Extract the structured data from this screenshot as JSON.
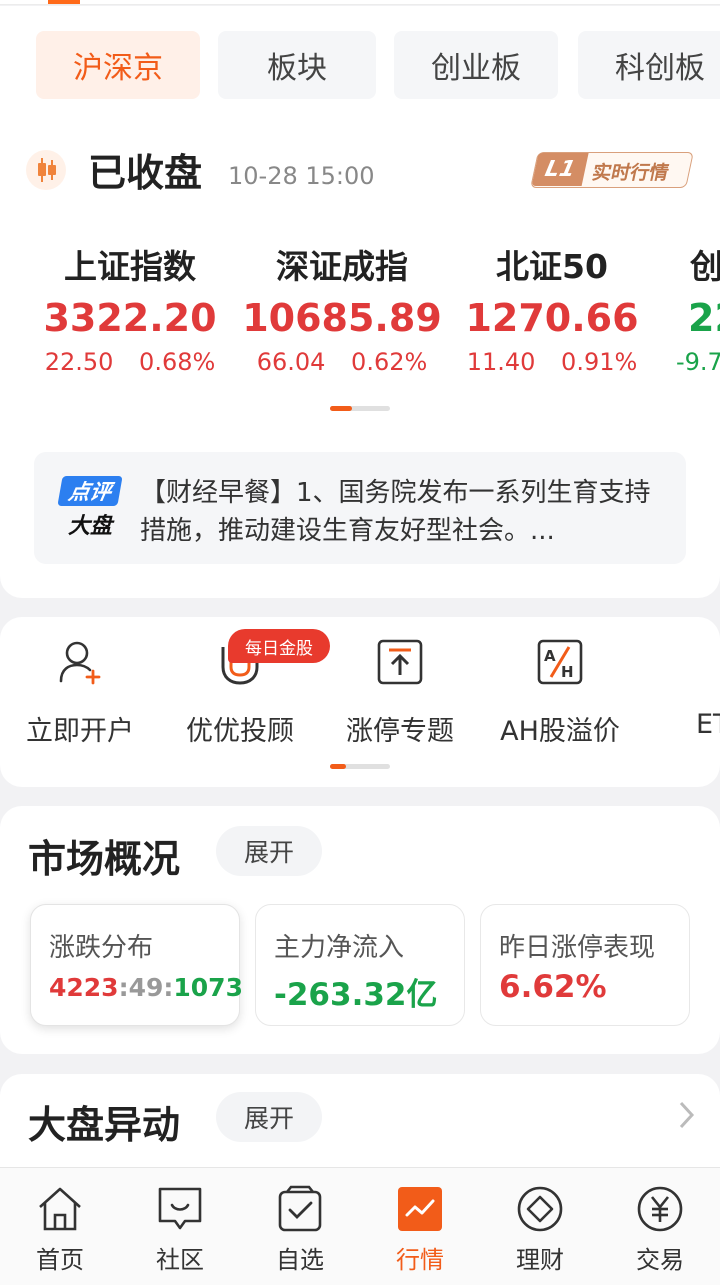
{
  "market_tabs": [
    {
      "label": "沪深京",
      "active": true
    },
    {
      "label": "板块",
      "active": false
    },
    {
      "label": "创业板",
      "active": false
    },
    {
      "label": "科创板",
      "active": false
    }
  ],
  "status": {
    "title": "已收盘",
    "time": "10-28 15:00",
    "badge_level": "L1",
    "badge_text": "实时行情"
  },
  "indices": [
    {
      "name": "上证指数",
      "price": "3322.20",
      "change": "22.50",
      "pct": "0.68%",
      "direction": "up"
    },
    {
      "name": "深证成指",
      "price": "10685.89",
      "change": "66.04",
      "pct": "0.62%",
      "direction": "up"
    },
    {
      "name": "北证50",
      "price": "1270.66",
      "change": "11.40",
      "pct": "0.91%",
      "direction": "up"
    },
    {
      "name": "创",
      "price": "22",
      "change": "-9.7",
      "pct": "",
      "direction": "down"
    }
  ],
  "news": {
    "badge_top": "点评",
    "badge_bottom": "大盘",
    "text": "【财经早餐】1、国务院发布一系列生育支持措施，推动建设生育友好型社会。..."
  },
  "shortcuts": [
    {
      "label": "立即开户",
      "icon": "user-plus-icon"
    },
    {
      "label": "优优投顾",
      "icon": "magnet-icon",
      "badge": "每日金股"
    },
    {
      "label": "涨停专题",
      "icon": "limit-up-icon"
    },
    {
      "label": "AH股溢价",
      "icon": "ah-premium-icon"
    },
    {
      "label": "ET",
      "icon": "etf-icon"
    }
  ],
  "market_overview": {
    "title": "市场概况",
    "expand_label": "展开",
    "cards": [
      {
        "label": "涨跌分布",
        "up": "4223",
        "flat": "49",
        "down": "1073"
      },
      {
        "label": "主力净流入",
        "value": "-263.32亿"
      },
      {
        "label": "昨日涨停表现",
        "value": "6.62%"
      }
    ]
  },
  "market_moves": {
    "title": "大盘异动",
    "expand_label": "展开"
  },
  "bottom_nav": [
    {
      "label": "首页",
      "icon": "home-icon"
    },
    {
      "label": "社区",
      "icon": "community-icon"
    },
    {
      "label": "自选",
      "icon": "watchlist-icon"
    },
    {
      "label": "行情",
      "icon": "market-icon",
      "active": true
    },
    {
      "label": "理财",
      "icon": "wealth-icon"
    },
    {
      "label": "交易",
      "icon": "trade-icon"
    }
  ],
  "colors": {
    "accent": "#f25c19",
    "up": "#e03a3a",
    "down": "#1aa34a"
  }
}
